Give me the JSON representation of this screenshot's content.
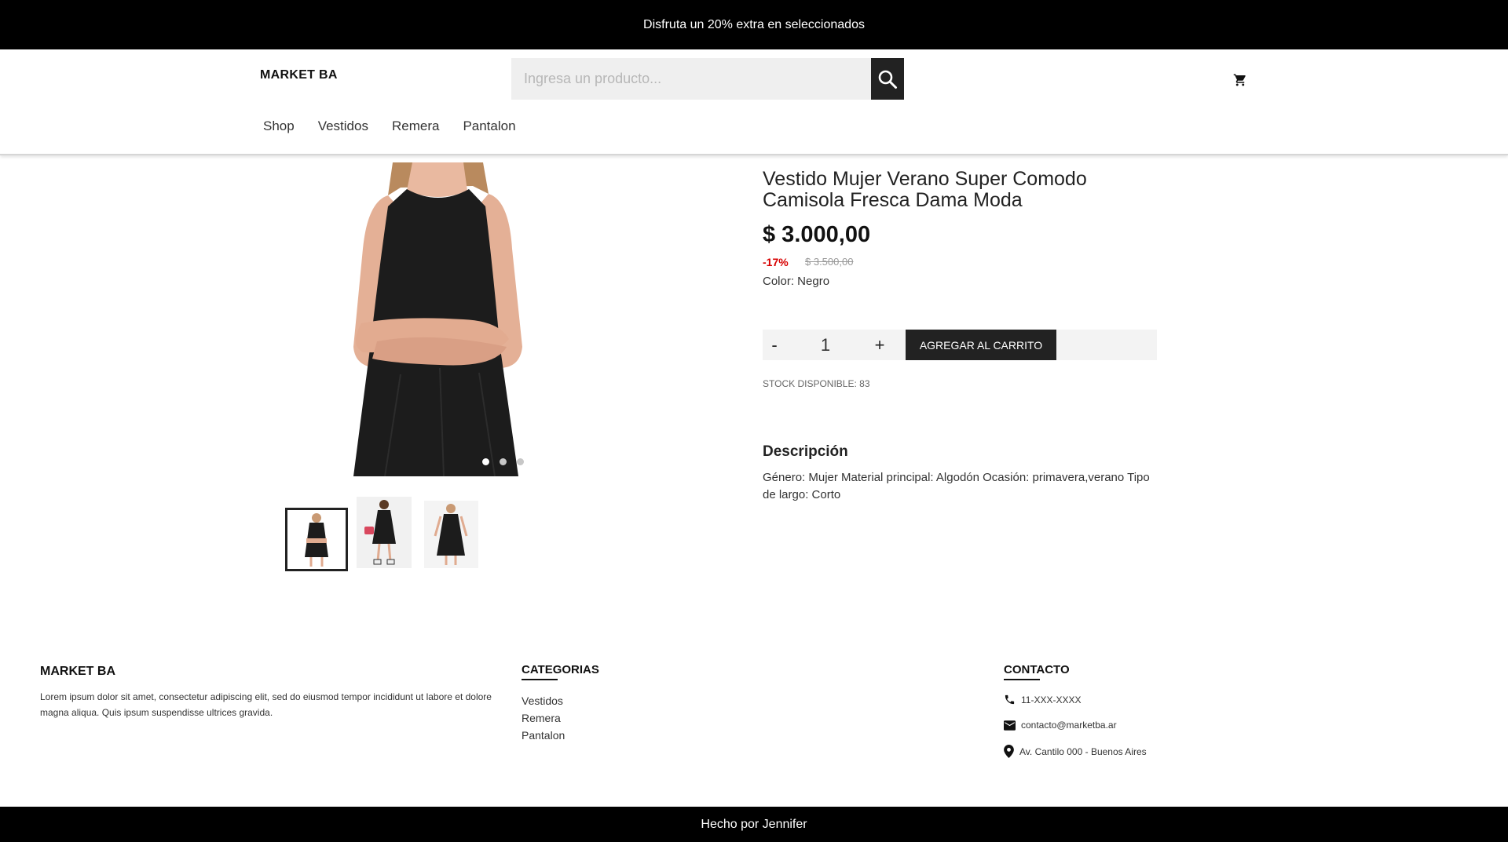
{
  "promo_bar": {
    "text": "Disfruta un 20% extra en seleccionados"
  },
  "header": {
    "logo": "MARKET BA",
    "search": {
      "placeholder": "Ingresa un producto...",
      "value": ""
    },
    "icons": {
      "search": "search-icon",
      "cart": "cart-icon"
    },
    "nav": [
      {
        "label": "Shop"
      },
      {
        "label": "Vestidos"
      },
      {
        "label": "Remera"
      },
      {
        "label": "Pantalon"
      }
    ]
  },
  "product": {
    "title": "Vestido Mujer Verano Super Comodo Camisola Fresca Dama Moda",
    "price": "$ 3.000,00",
    "discount": "-17%",
    "old_price": "$ 3.500,00",
    "color_line": "Color: Negro",
    "quantity": "1",
    "qty_minus": "-",
    "qty_plus": "+",
    "add_to_cart": "AGREGAR AL CARRITO",
    "stock": "STOCK DISPONIBLE: 83",
    "description_title": "Descripción",
    "description": "Género: Mujer Material principal: Algodón Ocasión: primavera,verano Tipo de largo: Corto",
    "carousel": {
      "slide_count": 3,
      "active_slide": 1
    },
    "thumbnails": [
      {
        "name": "thumbnail-1",
        "selected": true
      },
      {
        "name": "thumbnail-2",
        "selected": false
      },
      {
        "name": "thumbnail-3",
        "selected": false
      }
    ]
  },
  "footer": {
    "logo": "MARKET BA",
    "about": "Lorem ipsum dolor sit amet, consectetur adipiscing elit, sed do eiusmod tempor incididunt ut labore et dolore magna aliqua. Quis ipsum suspendisse ultrices gravida.",
    "categories_title": "CATEGORIAS",
    "categories": [
      {
        "label": "Vestidos"
      },
      {
        "label": "Remera"
      },
      {
        "label": "Pantalon"
      }
    ],
    "contact_title": "CONTACTO",
    "contact": {
      "phone": "11-XXX-XXXX",
      "email": "contacto@marketba.ar",
      "address": "Av. Cantilo 000 - Buenos Aires"
    },
    "credit": "Hecho por Jennifer"
  },
  "colors": {
    "bar_background": "#000000",
    "button_dark": "#222222",
    "discount_red": "#d70000",
    "input_bg": "#efefef"
  }
}
